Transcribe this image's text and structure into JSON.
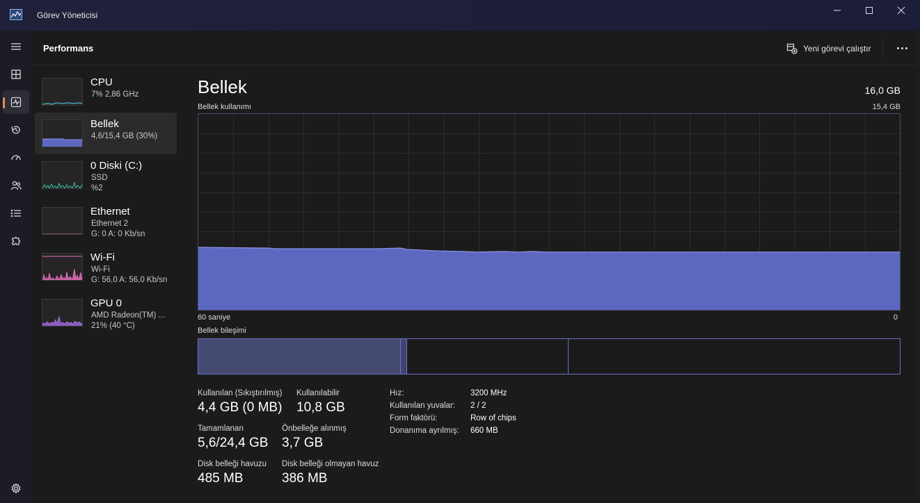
{
  "window": {
    "title": "Görev Yöneticisi",
    "app_icon": "chart-icon",
    "buttons": [
      "minimize-icon",
      "maximize-icon",
      "close-icon"
    ]
  },
  "nav": {
    "items": [
      {
        "name": "menu",
        "icon": "hamburger-icon"
      },
      {
        "name": "processes",
        "icon": "grid-icon"
      },
      {
        "name": "performance",
        "icon": "pulse-icon",
        "active": true
      },
      {
        "name": "app-history",
        "icon": "history-icon"
      },
      {
        "name": "startup",
        "icon": "speedometer-icon"
      },
      {
        "name": "users",
        "icon": "users-icon"
      },
      {
        "name": "details",
        "icon": "list-icon"
      },
      {
        "name": "services",
        "icon": "puzzle-icon"
      }
    ],
    "settings_icon": "gear-icon"
  },
  "header": {
    "title": "Performans",
    "new_task_label": "Yeni görevi çalıştır",
    "more_icon": "more-icon"
  },
  "resources": [
    {
      "name": "CPU",
      "line1": "7% 2,86 GHz",
      "line2": "",
      "color": "#4fb8d8",
      "active": false
    },
    {
      "name": "Bellek",
      "line1": "4,6/15,4 GB (30%)",
      "line2": "",
      "color": "#6a72d8",
      "active": true,
      "level": 0.3
    },
    {
      "name": "0 Diski (C:)",
      "line1": "SSD",
      "line2": "%2",
      "color": "#3cc6a8",
      "active": false
    },
    {
      "name": "Ethernet",
      "line1": "Ethernet 2",
      "line2": "G: 0 A: 0 Kb/sn",
      "color": "#d070a8",
      "active": false
    },
    {
      "name": "Wi-Fi",
      "line1": "Wi-Fi",
      "line2": "G: 56,0 A: 56,0 Kb/sn",
      "color": "#e070b8",
      "active": false
    },
    {
      "name": "GPU 0",
      "line1": "AMD Radeon(TM) ...",
      "line2": "21% (40 °C)",
      "color": "#a070d0",
      "active": false
    }
  ],
  "memory": {
    "title": "Bellek",
    "total": "16,0 GB",
    "usage_label": "Bellek kullanımı",
    "usage_max": "15,4 GB",
    "axis_left": "60 saniye",
    "axis_right": "0",
    "composition_label": "Bellek bileşimi",
    "graph_color": "#5c68c0",
    "graph_border": "#4b4b6b",
    "composition": {
      "in_use": 0.288,
      "modified": 0.01,
      "standby": 0.23,
      "free": 0.472
    }
  },
  "stats": {
    "in_use_label": "Kullanılan (Sıkıştırılmış)",
    "in_use_value": "4,4 GB (0 MB)",
    "available_label": "Kullanılabilir",
    "available_value": "10,8 GB",
    "committed_label": "Tamamlanan",
    "committed_value": "5,6/24,4 GB",
    "cached_label": "Önbelleğe alınmış",
    "cached_value": "3,7 GB",
    "paged_label": "Disk belleği havuzu",
    "paged_value": "485 MB",
    "nonpaged_label": "Disk belleği olmayan havuz",
    "nonpaged_value": "386 MB"
  },
  "specs": [
    {
      "key": "Hız:",
      "value": "3200 MHz"
    },
    {
      "key": "Kullanılan yuvalar:",
      "value": "2 / 2"
    },
    {
      "key": "Form faktörü:",
      "value": "Row of chips"
    },
    {
      "key": "Donanıma ayrılmış:",
      "value": "660 MB"
    }
  ]
}
